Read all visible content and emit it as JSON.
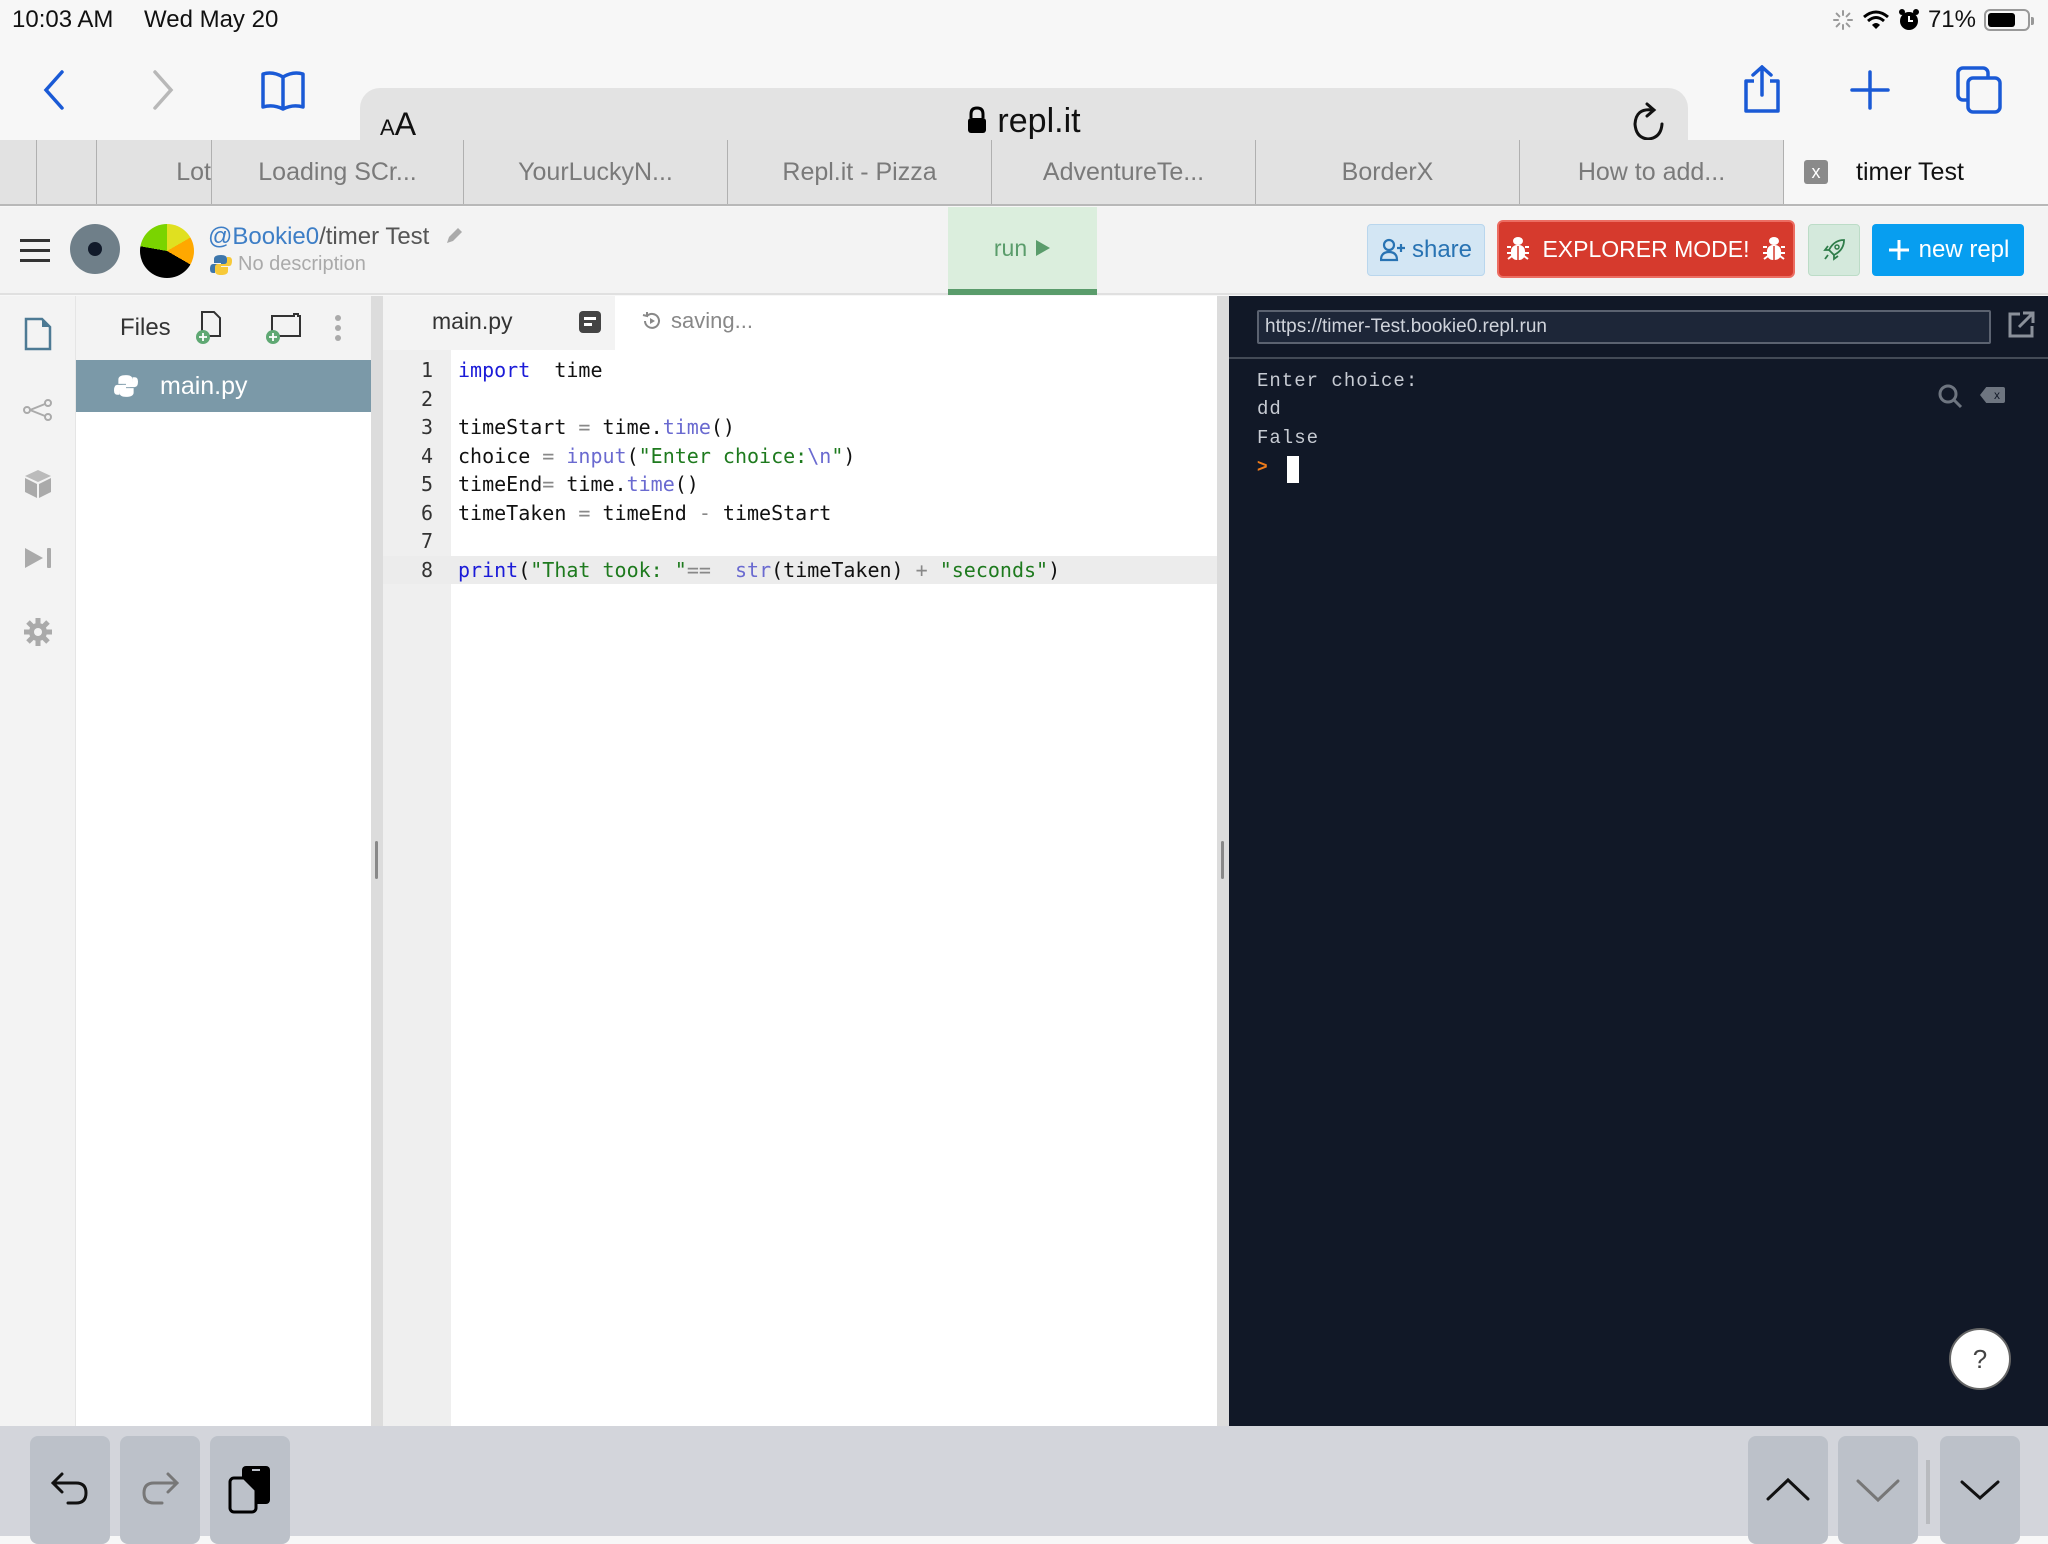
{
  "status_bar": {
    "time": "10:03 AM",
    "date": "Wed May 20",
    "battery_percent": "71%",
    "battery_level": 0.71,
    "icons": [
      "activity-spinner-icon",
      "wifi-icon",
      "alarm-icon",
      "battery-icon"
    ]
  },
  "browser": {
    "text_size_button": "AA",
    "url": "repl.it",
    "toolbar_icons": [
      "back-icon",
      "forward-icon",
      "bookmarks-icon",
      "reload-icon",
      "share-icon",
      "new-tab-icon",
      "tabs-icon"
    ]
  },
  "tabs": [
    {
      "label": ""
    },
    {
      "label": ""
    },
    {
      "label": "Lot"
    },
    {
      "label": "Loading SCr..."
    },
    {
      "label": "YourLuckyN..."
    },
    {
      "label": "Repl.it - Pizza"
    },
    {
      "label": "AdventureTe..."
    },
    {
      "label": "BorderX"
    },
    {
      "label": "How to add..."
    },
    {
      "label": "timer Test",
      "active": true,
      "close_label": "x"
    }
  ],
  "repl_header": {
    "user": "@Bookie0",
    "separator": "/",
    "repl_name": "timer Test",
    "description": "No description",
    "run_label": "run",
    "share_label": "share",
    "explorer_label": "EXPLORER MODE!",
    "new_repl_label": "new repl",
    "colors": {
      "run_bg": "#dbeedd",
      "run_accent": "#5a9c6b",
      "share_bg": "#d3e6f4",
      "explorer_bg": "#d63a2d",
      "new_repl_bg": "#079ef0",
      "user_link": "#3d7ec6"
    }
  },
  "activity_bar": {
    "items": [
      "files-icon",
      "version-control-icon",
      "packages-icon",
      "debugger-icon",
      "settings-icon"
    ]
  },
  "files_panel": {
    "title": "Files",
    "files": [
      {
        "name": "main.py",
        "selected": true
      }
    ]
  },
  "editor": {
    "tab_label": "main.py",
    "status": "saving...",
    "active_line": 8,
    "lines": [
      {
        "n": "1",
        "tokens": [
          [
            "kw",
            "import"
          ],
          [
            "",
            "  time"
          ]
        ]
      },
      {
        "n": "2",
        "tokens": []
      },
      {
        "n": "3",
        "tokens": [
          [
            "",
            "timeStart "
          ],
          [
            "op",
            "="
          ],
          [
            "",
            " time."
          ],
          [
            "fn",
            "time"
          ],
          [
            "",
            "()"
          ]
        ]
      },
      {
        "n": "4",
        "tokens": [
          [
            "",
            "choice "
          ],
          [
            "op",
            "="
          ],
          [
            "fn",
            " input"
          ],
          [
            "",
            "("
          ],
          [
            "str",
            "\"Enter choice:"
          ],
          [
            "esc",
            "\\n"
          ],
          [
            "str",
            "\""
          ],
          [
            "",
            ")"
          ]
        ]
      },
      {
        "n": "5",
        "tokens": [
          [
            "",
            "timeEnd"
          ],
          [
            "op",
            "="
          ],
          [
            "",
            " time."
          ],
          [
            "fn",
            "time"
          ],
          [
            "",
            "()"
          ]
        ]
      },
      {
        "n": "6",
        "tokens": [
          [
            "",
            "timeTaken "
          ],
          [
            "op",
            "="
          ],
          [
            "",
            " timeEnd "
          ],
          [
            "op",
            "-"
          ],
          [
            "",
            " timeStart"
          ]
        ]
      },
      {
        "n": "7",
        "tokens": []
      },
      {
        "n": "8",
        "tokens": [
          [
            "kw",
            "print"
          ],
          [
            "",
            "("
          ],
          [
            "str",
            "\"That took: \""
          ],
          [
            "op",
            "=="
          ],
          [
            "",
            "  "
          ],
          [
            "fn",
            "str"
          ],
          [
            "",
            "(timeTaken) "
          ],
          [
            "op",
            "+"
          ],
          [
            "",
            " "
          ],
          [
            "str",
            "\"seconds\""
          ],
          [
            "",
            ")"
          ]
        ]
      }
    ]
  },
  "console": {
    "webview_url": "https://timer-Test.bookie0.repl.run",
    "output": [
      "Enter choice:",
      "dd",
      "False"
    ],
    "prompt": ">",
    "help_label": "?",
    "clear_label": "x"
  },
  "keyboard_bar": {
    "buttons": [
      "undo-icon",
      "redo-icon",
      "paste-icon",
      "previous-field-icon",
      "next-field-icon",
      "dismiss-keyboard-icon"
    ]
  }
}
